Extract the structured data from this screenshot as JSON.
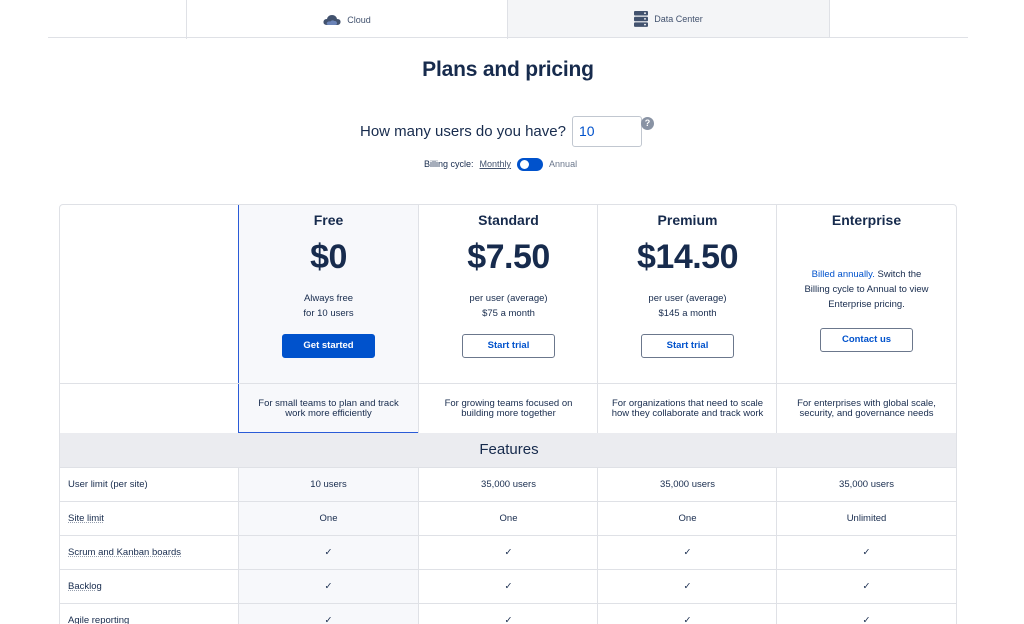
{
  "tabs": [
    {
      "label": "Cloud",
      "icon": "cloud-icon"
    },
    {
      "label": "Data Center",
      "icon": "server-icon"
    }
  ],
  "title": "Plans and pricing",
  "users": {
    "label": "How many users do you have?",
    "value": "10",
    "help": "?"
  },
  "billing": {
    "label": "Billing cycle:",
    "monthly": "Monthly",
    "annual": "Annual"
  },
  "plans": [
    {
      "name": "Free",
      "price": "$0",
      "sub1": "Always free",
      "sub2": "for 10 users",
      "button": "Get started",
      "desc": "For small teams to plan and track work more efficiently"
    },
    {
      "name": "Standard",
      "price": "$7.50",
      "sub1": "per user (average)",
      "sub2": "$75 a month",
      "button": "Start trial",
      "desc": "For growing teams focused on building more together"
    },
    {
      "name": "Premium",
      "price": "$14.50",
      "sub1": "per user (average)",
      "sub2": "$145 a month",
      "button": "Start trial",
      "desc": "For organizations that need to scale how they collaborate and track work"
    },
    {
      "name": "Enterprise",
      "note_link": "Billed annually.",
      "note_rest": " Switch the Billing cycle to Annual to view Enterprise pricing.",
      "button": "Contact us",
      "desc": "For enterprises with global scale, security, and governance needs"
    }
  ],
  "features_heading": "Features",
  "features": [
    {
      "name": "User limit (per site)",
      "values": [
        "10 users",
        "35,000 users",
        "35,000 users",
        "35,000 users"
      ]
    },
    {
      "name": "Site limit",
      "values": [
        "One",
        "One",
        "One",
        "Unlimited"
      ]
    },
    {
      "name": "Scrum and Kanban boards",
      "values": [
        "✓",
        "✓",
        "✓",
        "✓"
      ]
    },
    {
      "name": "Backlog",
      "values": [
        "✓",
        "✓",
        "✓",
        "✓"
      ]
    },
    {
      "name": "Agile reporting",
      "values": [
        "✓",
        "✓",
        "✓",
        "✓"
      ]
    }
  ],
  "colors": {
    "primary": "#0052cc",
    "text": "#172b4d",
    "free_border": "#2a5bd7",
    "features_bg": "#ebecf0"
  }
}
